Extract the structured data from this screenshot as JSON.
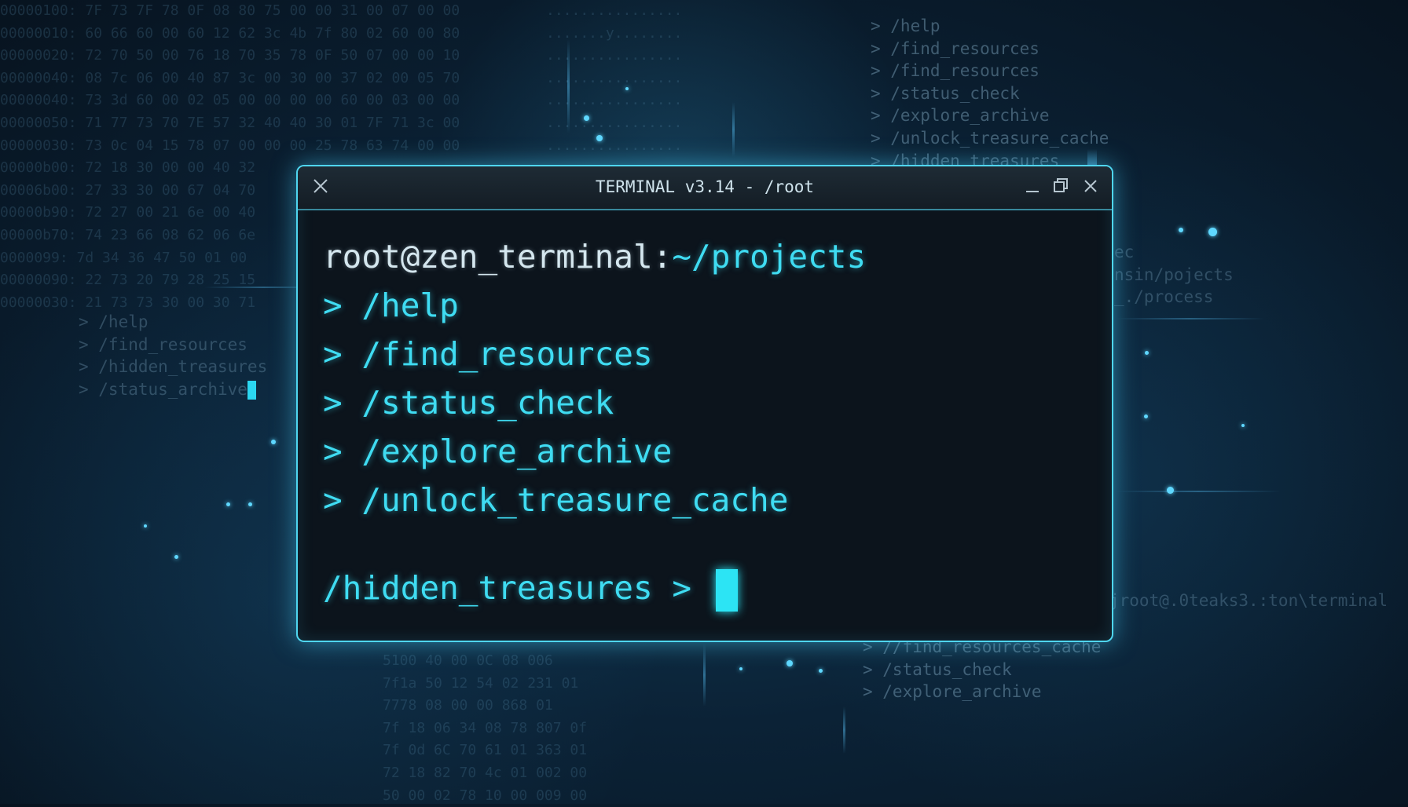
{
  "window": {
    "title": "TERMINAL v3.14 - /root"
  },
  "terminal": {
    "user_host": "root@zen_terminal:",
    "path": "~/projects",
    "commands": [
      "> /help",
      "> /find_resources",
      "> /status_check",
      "> /explore_archive",
      "> /unlock_treasure_cache"
    ],
    "prompt": "/hidden_treasures > "
  },
  "background": {
    "top_right_list": "> /help\n> /find_resources\n> /find_resources\n> /status_check\n> /explore_archive\n> /unlock_treasure_cache\n> /hidden_treasures",
    "left_list": "> /help\n> /find_resources\n> /hidden_treasures\n> /status_archive",
    "right_partial": "ec\nnsin/pojects\n_./process",
    "right_prompt": "jroot@.0teaks3.:ton\\terminal",
    "bottom_right_list": "> //find_resources_cache\n> /status_check\n> /explore_archive",
    "hex_left": "00000100: 7F 73 7F 78 0F 08 80 75 00 00 31 00 07 00 00\n00000010: 60 66 60 00 60 12 62 3c 4b 7f 80 02 60 00 80\n00000020: 72 70 50 00 76 18 70 35 78 0F 50 07 00 00 10\n00000040: 08 7c 06 00 40 87 3c 00 30 00 37 02 00 05 70\n00000040: 73 3d 60 00 02 05 00 00 00 00 60 00 03 00 00\n00000050: 71 77 73 70 7E 57 32 40 40 30 01 7F 71 3c 00\n00000030: 73 0c 04 15 78 07 00 00 00 25 78 63 74 00 00\n00000b00: 72 18 30 00 00 40 32\n00006b00: 27 33 30 00 67 04 70\n00000b90: 72 27 00 21 6e 00 40\n00000b70: 74 23 66 08 62 06 6e\n0000099: 7d 34 36 47 50 01 00\n00000090: 22 73 20 79 28 25 15\n00000030: 21 73 73 30 00 30 71",
    "hex_mid": "................\n.......y........\n................\n................\n................\n................\n................",
    "hex_bottom": "5100 40 00 0C 08 006\n7f1a 50 12 54 02 231 01\n7778 08 00 00 868 01\n7f 18 06 34 08 78 807 0f\n7f 0d 6C 70 61 01 363 01\n72 18 82 70 4c 01 002 00\n50 00 02 78 10 00 009 00"
  }
}
